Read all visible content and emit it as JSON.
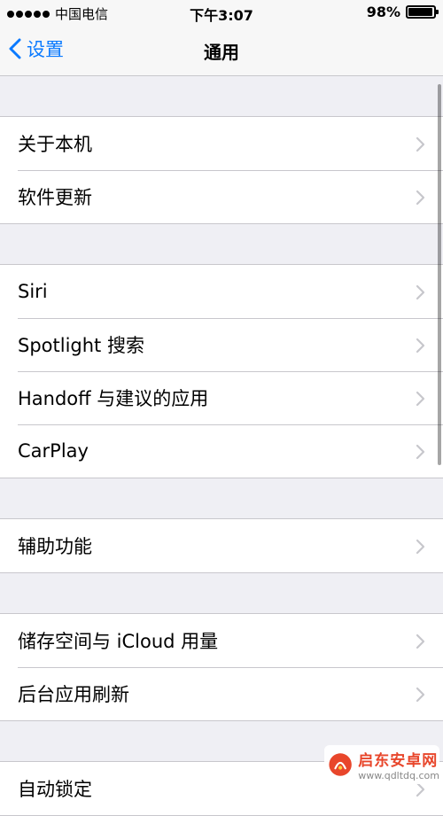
{
  "status_bar": {
    "carrier": "中国电信",
    "time": "下午3:07",
    "battery_percent": "98%",
    "battery_level": 0.98,
    "signal_dots": 5
  },
  "nav": {
    "back_label": "设置",
    "title": "通用"
  },
  "groups": [
    {
      "items": [
        {
          "label": "关于本机"
        },
        {
          "label": "软件更新"
        }
      ]
    },
    {
      "items": [
        {
          "label": "Siri"
        },
        {
          "label": "Spotlight 搜索"
        },
        {
          "label": "Handoff 与建议的应用"
        },
        {
          "label": "CarPlay"
        }
      ]
    },
    {
      "items": [
        {
          "label": "辅助功能"
        }
      ]
    },
    {
      "items": [
        {
          "label": "储存空间与 iCloud 用量"
        },
        {
          "label": "后台应用刷新"
        }
      ]
    },
    {
      "items": [
        {
          "label": "自动锁定"
        }
      ]
    }
  ],
  "watermark": {
    "name": "启东安卓网",
    "url": "www.qdltdq.com"
  },
  "colors": {
    "accent": "#0a7aff",
    "background": "#efeff4",
    "separator": "#c8c7cc",
    "chevron": "#c7c7cc"
  }
}
